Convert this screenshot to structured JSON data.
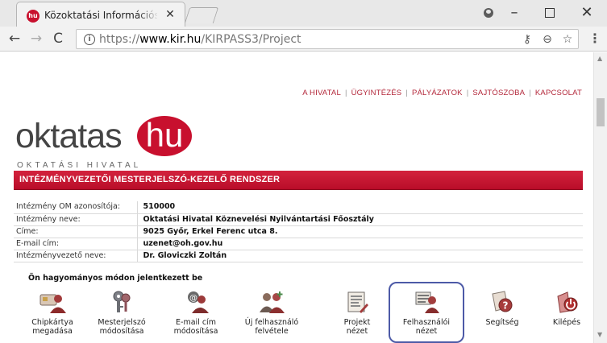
{
  "browser": {
    "tab_title": "Közoktatási Információs r",
    "tab_favicon_text": "hu",
    "url_scheme": "https://",
    "url_host": "www.kir.hu",
    "url_path": "/KIRPASS3/Project"
  },
  "topnav": [
    {
      "label": "A HIVATAL"
    },
    {
      "label": "ÜGYINTÉZÉS"
    },
    {
      "label": "PÁLYÁZATOK"
    },
    {
      "label": "SAJTÓSZOBA"
    },
    {
      "label": "KAPCSOLAT"
    }
  ],
  "logo": {
    "word": "oktatas",
    "bubble": "hu",
    "tagline": "OKTATÁSI HIVATAL"
  },
  "banner": {
    "title": "INTÉZMÉNYVEZETŐI MESTERJELSZÓ-KEZELŐ RENDSZER"
  },
  "institution": {
    "rows": [
      {
        "label": "Intézmény OM azonosítója:",
        "value": "510000"
      },
      {
        "label": "Intézmény neve:",
        "value": "Oktatási Hivatal Köznevelési Nyilvántartási Főosztály"
      },
      {
        "label": "Címe:",
        "value": "9025 Győr, Erkel Ferenc utca 8."
      },
      {
        "label": "E-mail cím:",
        "value": "uzenet@oh.gov.hu"
      },
      {
        "label": "Intézményvezető neve:",
        "value": "Dr. Gloviczki Zoltán"
      }
    ]
  },
  "login_note": "Ön hagyományos módon jelentkezett be",
  "actions": [
    {
      "label": "Chipkártya\nmegadása",
      "icon": "chipcard-user-icon"
    },
    {
      "label": "Mesterjelszó\nmódosítása",
      "icon": "keys-icon"
    },
    {
      "label": "E-mail cím\nmódosítása",
      "icon": "email-user-icon"
    },
    {
      "label": "Új felhasználó\nfelvétele",
      "icon": "new-user-icon"
    },
    {
      "label": "Projekt\nnézet",
      "icon": "project-document-icon"
    },
    {
      "label": "Felhasználói\nnézet",
      "icon": "user-view-icon",
      "selected": true
    },
    {
      "label": "Segítség",
      "icon": "help-icon"
    },
    {
      "label": "Kilépés",
      "icon": "exit-icon"
    }
  ],
  "colors": {
    "brand_red": "#c8102e",
    "highlight_border": "#4d5aa7"
  }
}
